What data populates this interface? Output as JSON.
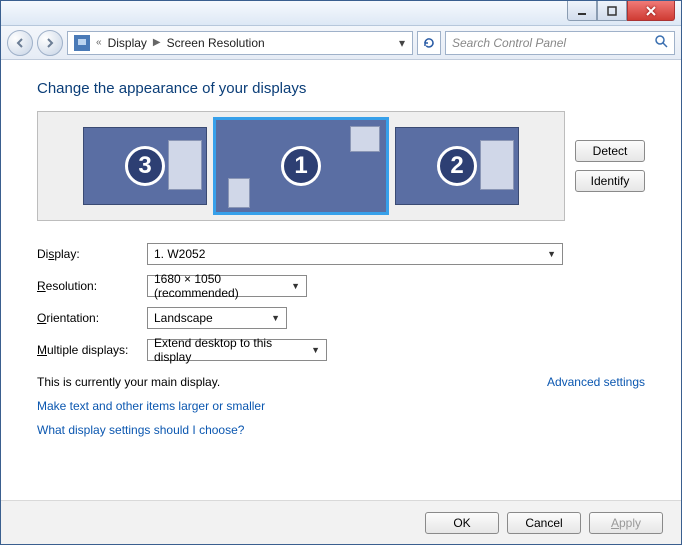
{
  "breadcrumb": {
    "seg1": "Display",
    "seg2": "Screen Resolution"
  },
  "search": {
    "placeholder": "Search Control Panel"
  },
  "heading": "Change the appearance of your displays",
  "monitors": {
    "m1": "1",
    "m2": "2",
    "m3": "3"
  },
  "side": {
    "detect": "Detect",
    "identify": "Identify"
  },
  "form": {
    "display_label_pre": "Di",
    "display_label_u": "s",
    "display_label_post": "play:",
    "display_value": "1. W2052",
    "resolution_label_u": "R",
    "resolution_label_post": "esolution:",
    "resolution_value": "1680 × 1050 (recommended)",
    "orientation_label_u": "O",
    "orientation_label_post": "rientation:",
    "orientation_value": "Landscape",
    "multiple_label_u": "M",
    "multiple_label_post": "ultiple displays:",
    "multiple_value": "Extend desktop to this display"
  },
  "status": "This is currently your main display.",
  "advanced": "Advanced settings",
  "link1": "Make text and other items larger or smaller",
  "link2": "What display settings should I choose?",
  "footer": {
    "ok": "OK",
    "cancel": "Cancel",
    "apply_u": "A",
    "apply_post": "pply"
  }
}
